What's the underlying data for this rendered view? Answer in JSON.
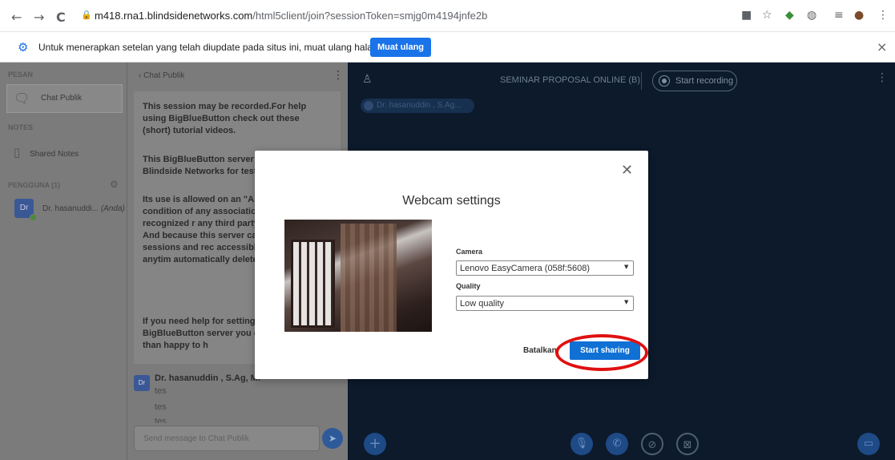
{
  "browser": {
    "back": "←",
    "forward": "→",
    "reload": "C",
    "url_domain": "m418.rna1.blindsidenetworks.com",
    "url_path": "/html5client/join?sessionToken=smjg0m4194jnfe2b"
  },
  "infobar": {
    "message": "Untuk menerapkan setelan yang telah diupdate pada situs ini, muat ulang halaman ini",
    "reload_label": "Muat ulang",
    "close": "×"
  },
  "sidebar": {
    "messages_title": "PESAN",
    "chat_item": "Chat Publik",
    "notes_title": "NOTES",
    "shared_notes": "Shared Notes",
    "users_title": "PENGGUNA (1)",
    "user_avatar": "Dr",
    "user_name": "Dr. hasanuddi...",
    "user_you": "(Anda)"
  },
  "chat": {
    "header": "‹ Chat Publik",
    "welcome": [
      "This session may be recorded.For help using BigBlueButton check out these (short) tutorial videos.",
      "This BigBlueButton server is provided by Blindside Networks for testi",
      "Its use is allowed on an \"AS IS\" warranty or condition of any association nor recognized r any third party web sites link And because this server can openly, your sessions and rec accessible for anyone, anytim automatically delete after 7 c",
      "If you need help for setting u BigBlueButton server you ca will be more than happy to h"
    ],
    "msg_avatar": "Dr",
    "msg_name": "Dr. hasanuddin , S.Ag, M.",
    "msg_lines": [
      "tes",
      "tes",
      "tes"
    ],
    "input_placeholder": "Send message to Chat Publik"
  },
  "main": {
    "meeting_title": "SEMINAR PROPOSAL ONLINE (B)",
    "record_label": "Start recording",
    "talker": "Dr. hasanuddin , S.Ag..."
  },
  "modal": {
    "title": "Webcam settings",
    "camera_label": "Camera",
    "camera_value": "Lenovo EasyCamera (058f:5608)",
    "quality_label": "Quality",
    "quality_value": "Low quality",
    "cancel_label": "Batalkan",
    "share_label": "Start sharing"
  },
  "colors": {
    "accent": "#1a73e8",
    "share_button": "#1070d4",
    "main_bg": "#0c1a2b",
    "annotation": "#e01010"
  }
}
